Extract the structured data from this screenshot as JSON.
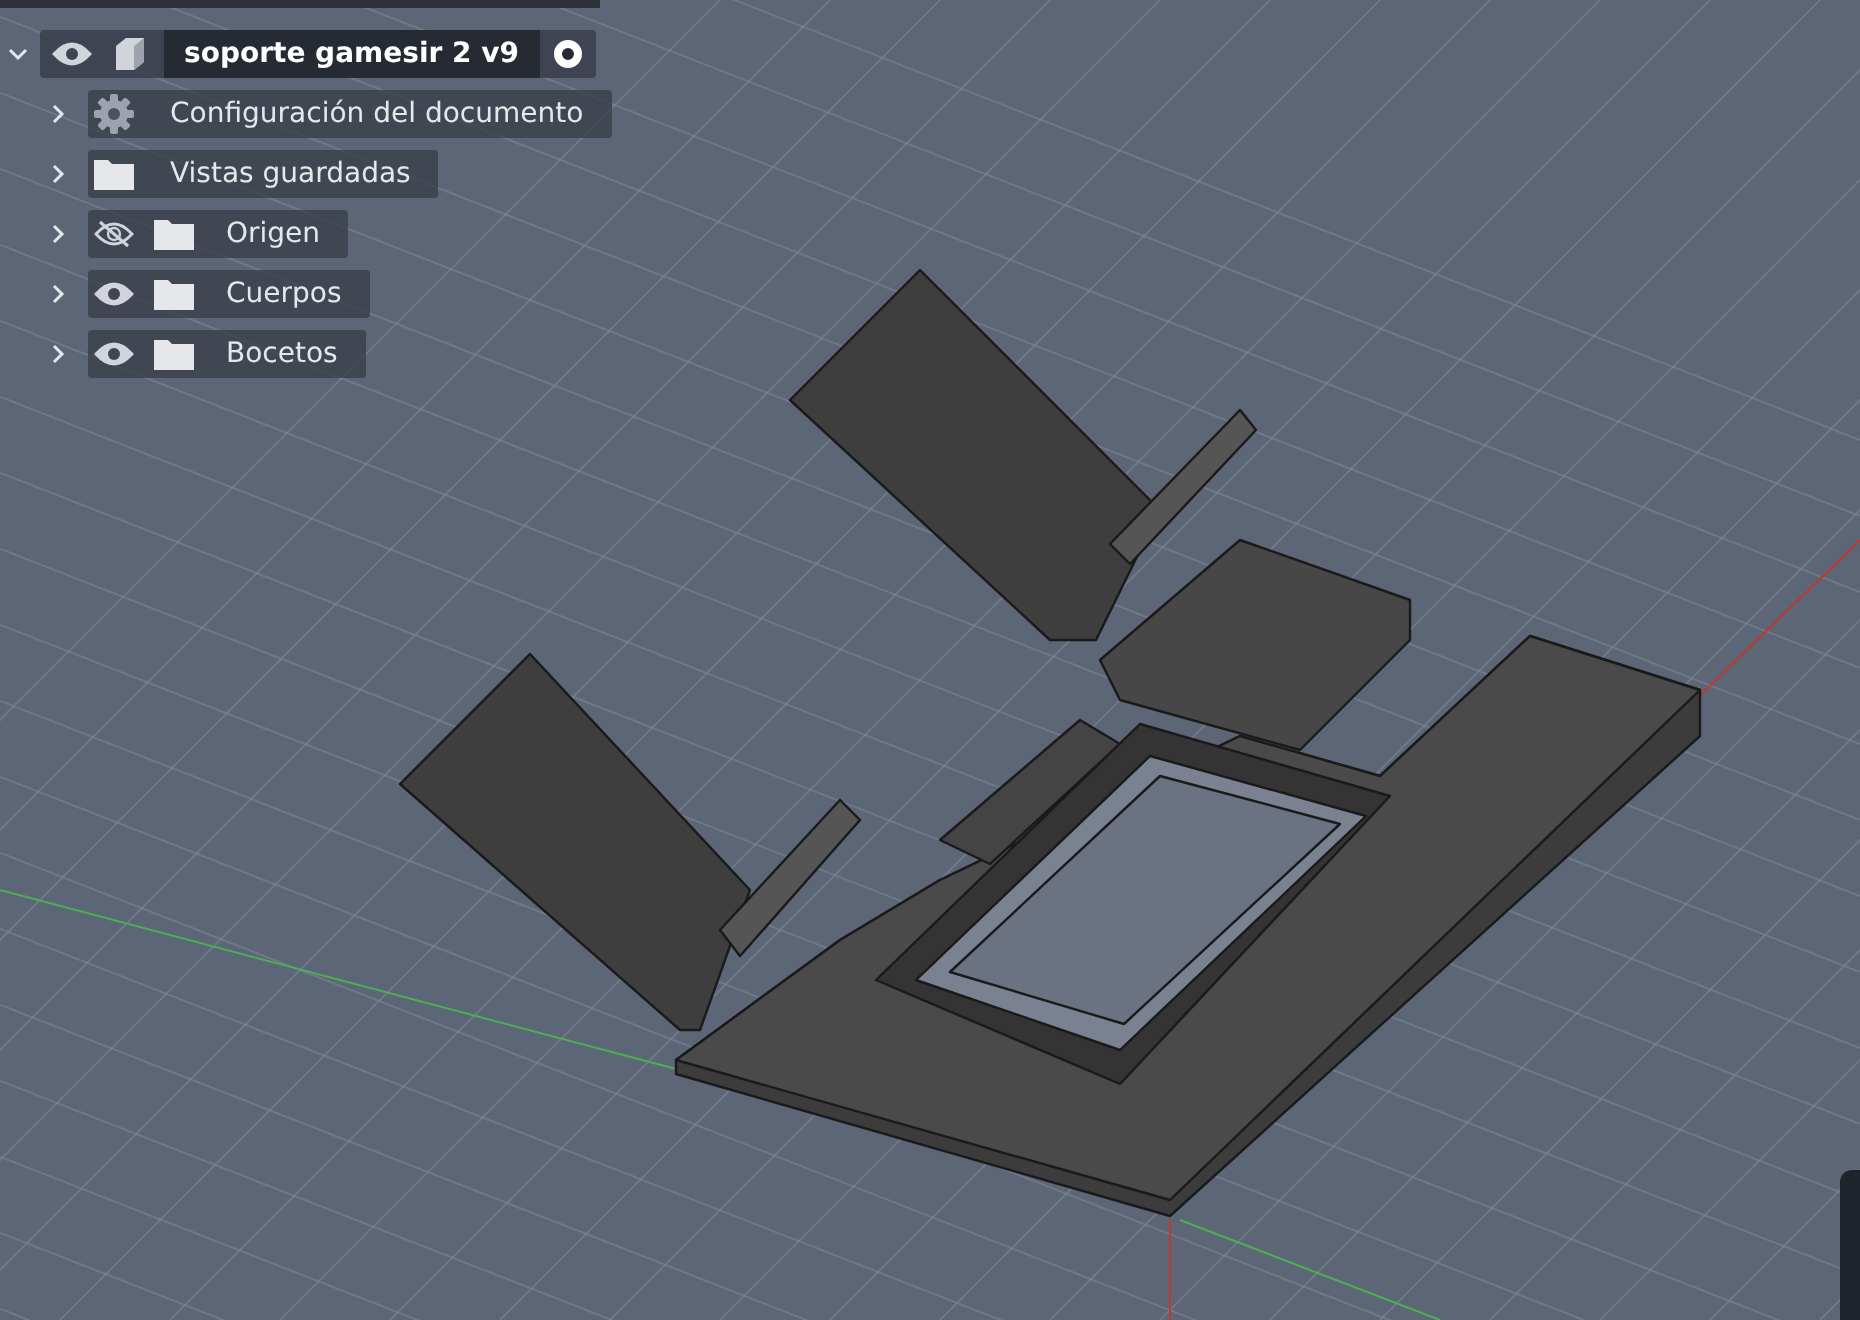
{
  "browser": {
    "root": {
      "label": "soporte gamesir 2 v9",
      "expanded": true,
      "visible": true,
      "active": true
    },
    "items": [
      {
        "kind": "settings",
        "label": "Configuración del documento",
        "expanded": false
      },
      {
        "kind": "folder",
        "label": "Vistas guardadas",
        "expanded": false
      },
      {
        "kind": "folder",
        "label": "Origen",
        "expanded": false,
        "visible": false
      },
      {
        "kind": "folder",
        "label": "Cuerpos",
        "expanded": false,
        "visible": true
      },
      {
        "kind": "folder",
        "label": "Bocetos",
        "expanded": false,
        "visible": true
      }
    ]
  }
}
